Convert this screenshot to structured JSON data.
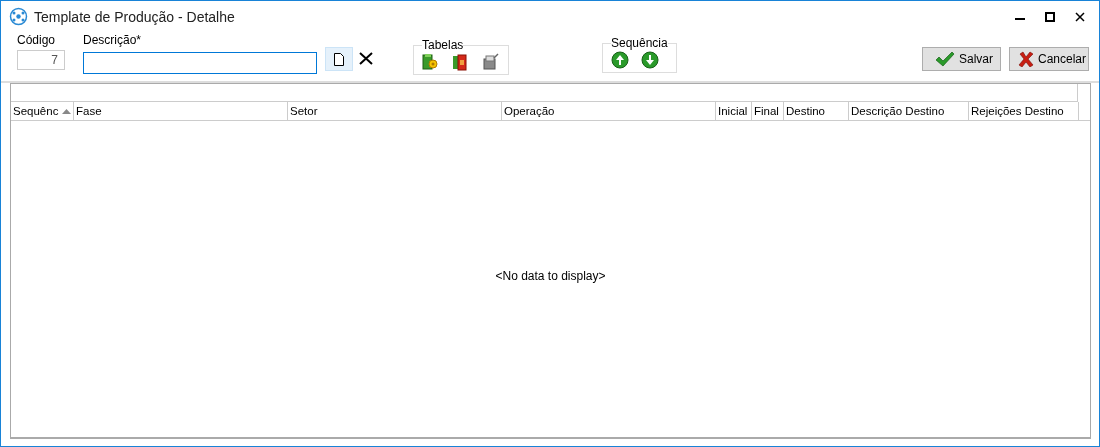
{
  "window": {
    "title": "Template de Produção - Detalhe"
  },
  "fields": {
    "codigo": {
      "label": "Código",
      "value": "7"
    },
    "descricao": {
      "label": "Descrição*",
      "focused": true
    }
  },
  "groups": [
    {
      "title": "Tabelas",
      "kind": "tables"
    },
    {
      "title": "Sequência",
      "kind": "sequence"
    }
  ],
  "buttons": [
    {
      "label": "Salvar",
      "kind": "save"
    },
    {
      "label": "Cancelar",
      "kind": "cancel"
    }
  ],
  "table": {
    "columns": [
      {
        "label": "Sequênc",
        "sorted": true
      },
      {
        "label": "Fase",
        "sorted": false
      },
      {
        "label": "Setor",
        "sorted": false
      },
      {
        "label": "Operação",
        "sorted": false
      },
      {
        "label": "Inicial",
        "sorted": false
      },
      {
        "label": "Final",
        "sorted": false
      },
      {
        "label": "Destino",
        "sorted": false
      },
      {
        "label": "Descrição Destino",
        "sorted": false
      },
      {
        "label": "Rejeições Destino",
        "sorted": false
      }
    ],
    "empty_text": "<No data to display>"
  }
}
